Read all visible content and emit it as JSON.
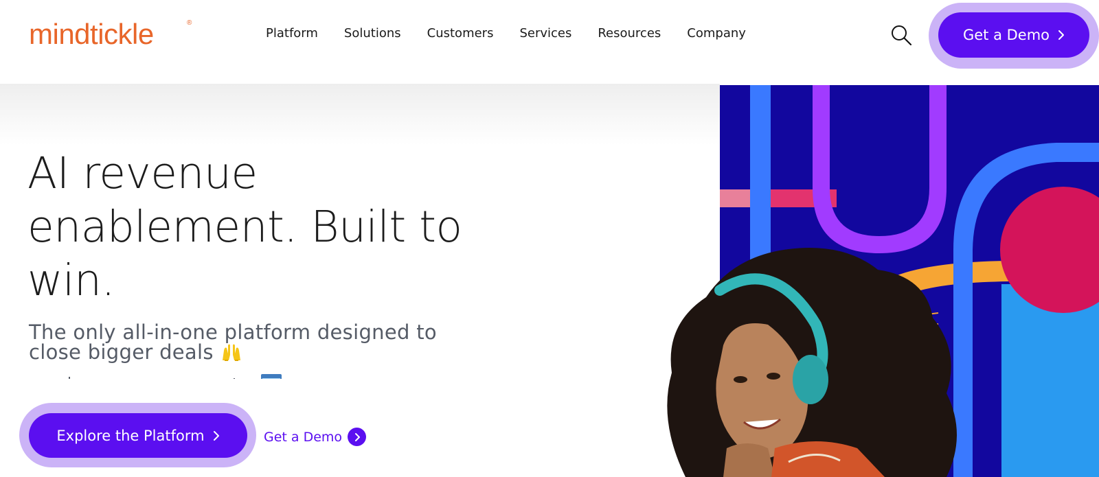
{
  "header": {
    "logo_text": "mindtickle",
    "logo_mark": "®",
    "nav": [
      "Platform",
      "Solutions",
      "Customers",
      "Services",
      "Resources",
      "Company"
    ],
    "search_icon": "search-icon",
    "demo_label": "Get a Demo"
  },
  "hero": {
    "headline": "AI revenue enablement. Built to win.",
    "subhead": "The only all-in-one platform designed to close bigger deals",
    "explore_label": "Explore the Platform",
    "link_demo_label": "Get a Demo"
  },
  "colors": {
    "brand_purple": "#5b0ff0",
    "halo": "#cbb3f7",
    "logo_orange": "#e8662a",
    "art_navy": "#12079e"
  }
}
